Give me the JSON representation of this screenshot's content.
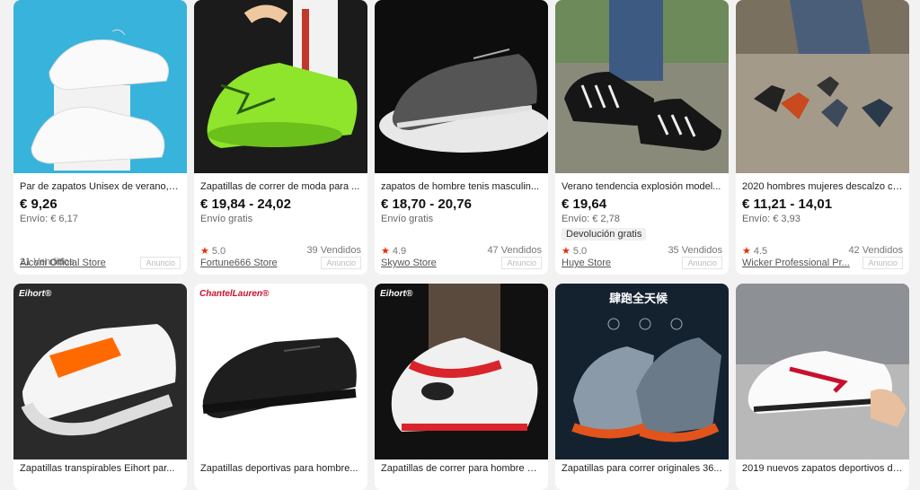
{
  "row1": [
    {
      "title": "Par de zapatos Unisex de verano, z...",
      "price": "€ 9,26",
      "shipping": "Envío: € 6,17",
      "badge": "",
      "rating": "",
      "sold": "21 Vendidos",
      "store": "Aiconi Official Store",
      "ad": "Anuncio"
    },
    {
      "title": "Zapatillas de correr de moda para ...",
      "price": "€ 19,84 - 24,02",
      "shipping": "Envío gratis",
      "badge": "",
      "rating": "5.0",
      "sold": "39 Vendidos",
      "store": "Fortune666 Store",
      "ad": "Anuncio"
    },
    {
      "title": "zapatos de hombre tenis masculin...",
      "price": "€ 18,70 - 20,76",
      "shipping": "Envío gratis",
      "badge": "",
      "rating": "4.9",
      "sold": "47 Vendidos",
      "store": "Skywo Store",
      "ad": "Anuncio"
    },
    {
      "title": "Verano tendencia explosión model...",
      "price": "€ 19,64",
      "shipping": "Envío: € 2,78",
      "badge": "Devolución gratis",
      "rating": "5.0",
      "sold": "35 Vendidos",
      "store": "Huye Store",
      "ad": "Anuncio"
    },
    {
      "title": "2020 hombres mujeres descalzo ci...",
      "price": "€ 11,21 - 14,01",
      "shipping": "Envío: € 3,93",
      "badge": "",
      "rating": "4.5",
      "sold": "42 Vendidos",
      "store": "Wicker Professional Pr...",
      "ad": "Anuncio"
    }
  ],
  "row2": [
    {
      "title": "Zapatillas transpirables Eihort par...",
      "brand": "Eihort®"
    },
    {
      "title": "Zapatillas deportivas para hombre...",
      "brand": "ChantelLauren®"
    },
    {
      "title": "Zapatillas de correr para hombre E...",
      "brand": "Eihort®"
    },
    {
      "title": "Zapatillas para correr originales 36...",
      "brand": "肆跑全天候"
    },
    {
      "title": "2019 nuevos zapatos deportivos de...",
      "brand": ""
    }
  ],
  "rating_star": "★",
  "colors": {
    "price": "#111111",
    "star": "#e62e04",
    "page_bg": "#f2f2f2"
  }
}
